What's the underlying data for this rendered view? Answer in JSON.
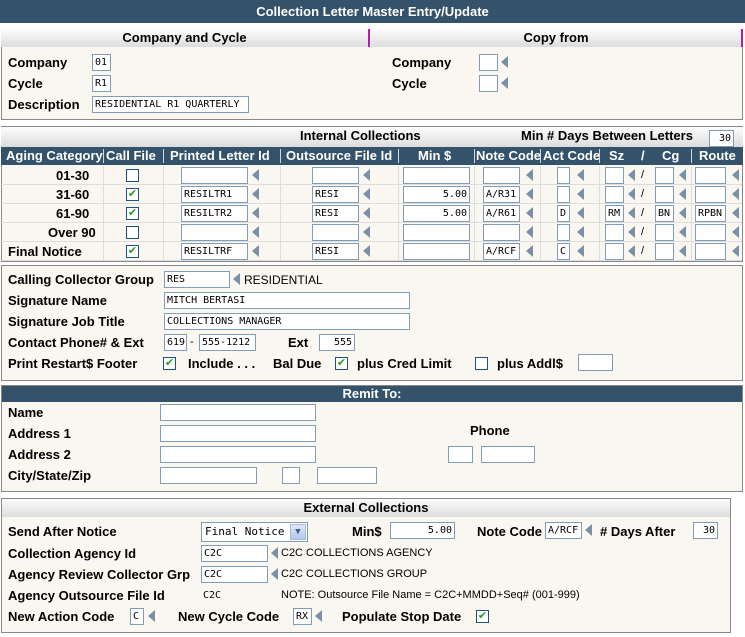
{
  "window": {
    "title": "Collection Letter Master Entry/Update"
  },
  "company_cycle": {
    "header": "Company and Cycle",
    "company_label": "Company",
    "company_value": "01",
    "cycle_label": "Cycle",
    "cycle_value": "R1",
    "description_label": "Description",
    "description_value": "RESIDENTIAL R1 QUARTERLY"
  },
  "copy_from": {
    "header": "Copy from",
    "company_label": "Company",
    "company_value": "",
    "cycle_label": "Cycle",
    "cycle_value": ""
  },
  "internal": {
    "header": "Internal Collections",
    "min_days_label": "Min # Days Between Letters",
    "min_days_value": "30",
    "columns": [
      "Aging Category",
      "Call File",
      "Printed Letter Id",
      "Outsource File Id",
      "Min $",
      "Note Code",
      "Act Code",
      "Sz",
      "/",
      "Cg",
      "Route"
    ],
    "rows": [
      {
        "category": "01-30",
        "call_file": false,
        "letter_id": "",
        "outsource_id": "",
        "min": "",
        "note_code": "",
        "act_code": "",
        "sz": "",
        "cg": "",
        "route": ""
      },
      {
        "category": "31-60",
        "call_file": true,
        "letter_id": "RESILTR1",
        "outsource_id": "RESI",
        "min": "5.00",
        "note_code": "A/R31",
        "act_code": "",
        "sz": "",
        "cg": "",
        "route": ""
      },
      {
        "category": "61-90",
        "call_file": true,
        "letter_id": "RESILTR2",
        "outsource_id": "RESI",
        "min": "5.00",
        "note_code": "A/R61",
        "act_code": "D",
        "sz": "RM",
        "cg": "BN",
        "route": "RPBN"
      },
      {
        "category": "Over 90",
        "call_file": false,
        "letter_id": "",
        "outsource_id": "",
        "min": "",
        "note_code": "",
        "act_code": "",
        "sz": "",
        "cg": "",
        "route": ""
      },
      {
        "category": "Final Notice",
        "call_file": true,
        "letter_id": "RESILTRF",
        "outsource_id": "RESI",
        "min": "",
        "note_code": "A/RCF",
        "act_code": "C",
        "sz": "",
        "cg": "",
        "route": ""
      }
    ]
  },
  "signature": {
    "collector_group_label": "Calling Collector Group",
    "collector_group_value": "RES",
    "collector_group_desc": "RESIDENTIAL",
    "sig_name_label": "Signature Name",
    "sig_name_value": "MITCH BERTASI",
    "sig_title_label": "Signature Job Title",
    "sig_title_value": "COLLECTIONS MANAGER",
    "phone_label": "Contact Phone# & Ext",
    "phone_area": "619",
    "phone_dash": "-",
    "phone_number": "555-1212",
    "ext_label": "Ext",
    "ext_value": "555",
    "footer_label": "Print Restart$ Footer",
    "footer_checked": true,
    "include_label": "Include . . .",
    "bal_due_label": "Bal Due",
    "cred_limit_checked": true,
    "cred_limit_label": "plus Cred Limit",
    "addl_checked": false,
    "addl_label": "plus Addl$",
    "addl_value": ""
  },
  "remit": {
    "header": "Remit To:",
    "name_label": "Name",
    "address1_label": "Address 1",
    "address2_label": "Address 2",
    "city_label": "City/State/Zip",
    "phone_label": "Phone",
    "name_value": "",
    "address1_value": "",
    "address2_value": "",
    "city_value": "",
    "state_value": "",
    "zip_value": "",
    "phone_area": "",
    "phone_number": ""
  },
  "external": {
    "header": "External Collections",
    "send_after_label": "Send After Notice",
    "send_after_value": "Final Notice",
    "min_label": "Min$",
    "min_value": "5.00",
    "note_code_label": "Note Code",
    "note_code_value": "A/RCF",
    "days_after_label": "# Days After",
    "days_after_value": "30",
    "agency_id_label": "Collection Agency Id",
    "agency_id_value": "C2C",
    "agency_id_desc": "C2C COLLECTIONS AGENCY",
    "review_grp_label": "Agency Review Collector Grp",
    "review_grp_value": "C2C",
    "review_grp_desc": "C2C COLLECTIONS GROUP",
    "outsource_label": "Agency Outsource File Id",
    "outsource_value": "C2C",
    "outsource_note": "NOTE: Outsource File Name = C2C+MMDD+Seq# (001-999)",
    "new_action_label": "New Action Code",
    "new_action_value": "C",
    "new_cycle_label": "New Cycle Code",
    "new_cycle_value": "RX",
    "stop_date_label": "Populate Stop Date",
    "stop_date_checked": true
  },
  "icons": {
    "lookup": "left-triangle-lookup-icon",
    "check": "checkmark-icon",
    "dropdown": "chevron-down-icon"
  }
}
